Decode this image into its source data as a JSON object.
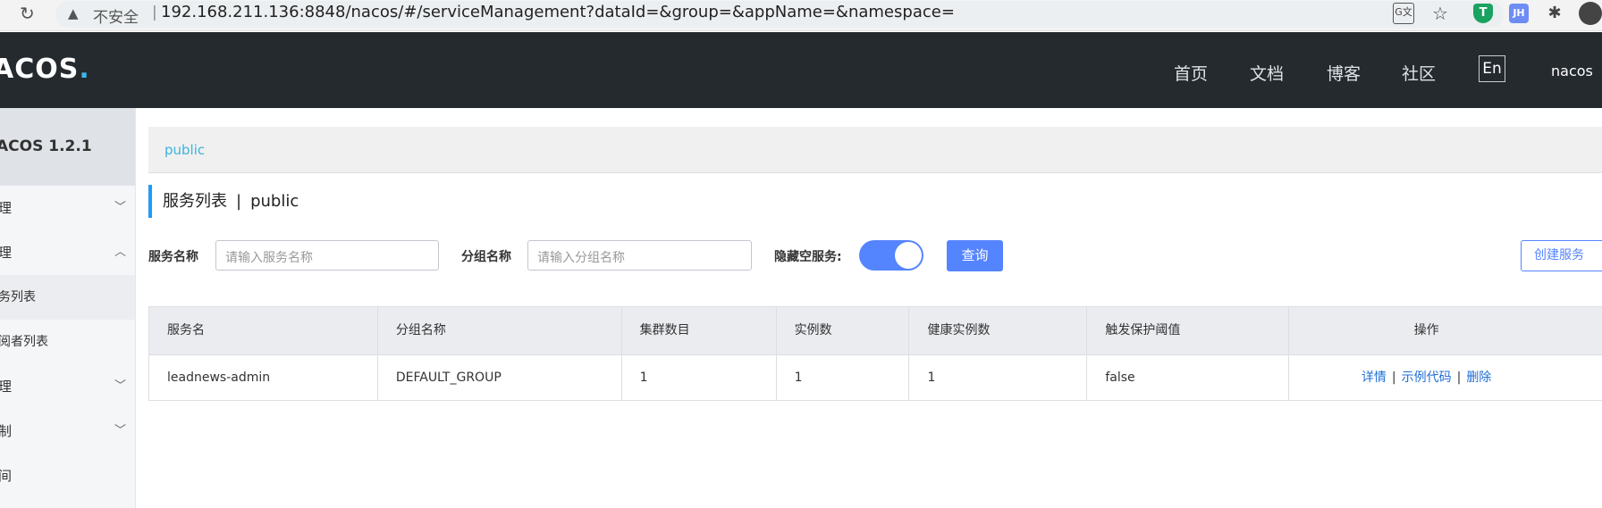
{
  "browser": {
    "insecure_label": "不安全",
    "url": "192.168.211.136:8848/nacos/#/serviceManagement?dataId=&group=&appName=&namespace=",
    "extension_jh_label": "JH",
    "icons": [
      "back-icon",
      "reload-icon",
      "warning-icon",
      "translate-icon",
      "star-icon",
      "shield-extension-icon",
      "jh-extension-icon",
      "puzzle-icon",
      "profile-icon"
    ]
  },
  "header": {
    "logo": "ACOS",
    "nav": {
      "home": "首页",
      "docs": "文档",
      "blog": "博客",
      "community": "社区"
    },
    "lang_button": "En",
    "user": "nacos"
  },
  "sidebar": {
    "version": "ACOS 1.2.1",
    "items": [
      {
        "label": "理",
        "chevron": "﹀"
      },
      {
        "label": "理",
        "chevron": "︿"
      },
      {
        "label": "务列表"
      },
      {
        "label": "阅者列表"
      },
      {
        "label": "理",
        "chevron": "﹀"
      },
      {
        "label": "制",
        "chevron": "﹀"
      },
      {
        "label": "间"
      }
    ]
  },
  "breadcrumb": {
    "namespace": "public"
  },
  "page": {
    "title": "服务列表",
    "divider": "|",
    "namespace": "public"
  },
  "filters": {
    "service_name_label": "服务名称",
    "service_name_placeholder": "请输入服务名称",
    "group_name_label": "分组名称",
    "group_name_placeholder": "请输入分组名称",
    "hide_empty_label": "隐藏空服务:",
    "hide_empty_on": true,
    "query_button": "查询",
    "create_button": "创建服务"
  },
  "table": {
    "columns": [
      "服务名",
      "分组名称",
      "集群数目",
      "实例数",
      "健康实例数",
      "触发保护阈值",
      "操作"
    ],
    "rows": [
      {
        "service_name": "leadnews-admin",
        "group_name": "DEFAULT_GROUP",
        "cluster_count": "1",
        "instance_count": "1",
        "healthy_instance_count": "1",
        "protect_threshold": "false",
        "actions": {
          "detail": "详情",
          "sample_code": "示例代码",
          "delete": "删除",
          "sep": "|"
        }
      }
    ]
  },
  "colors": {
    "header_bg": "#252a2f",
    "accent_blue": "#5584ff",
    "link_blue": "#1f6fd6",
    "breadcrumb_cyan": "#3cb4dd",
    "title_bar_blue": "#209bfa"
  }
}
